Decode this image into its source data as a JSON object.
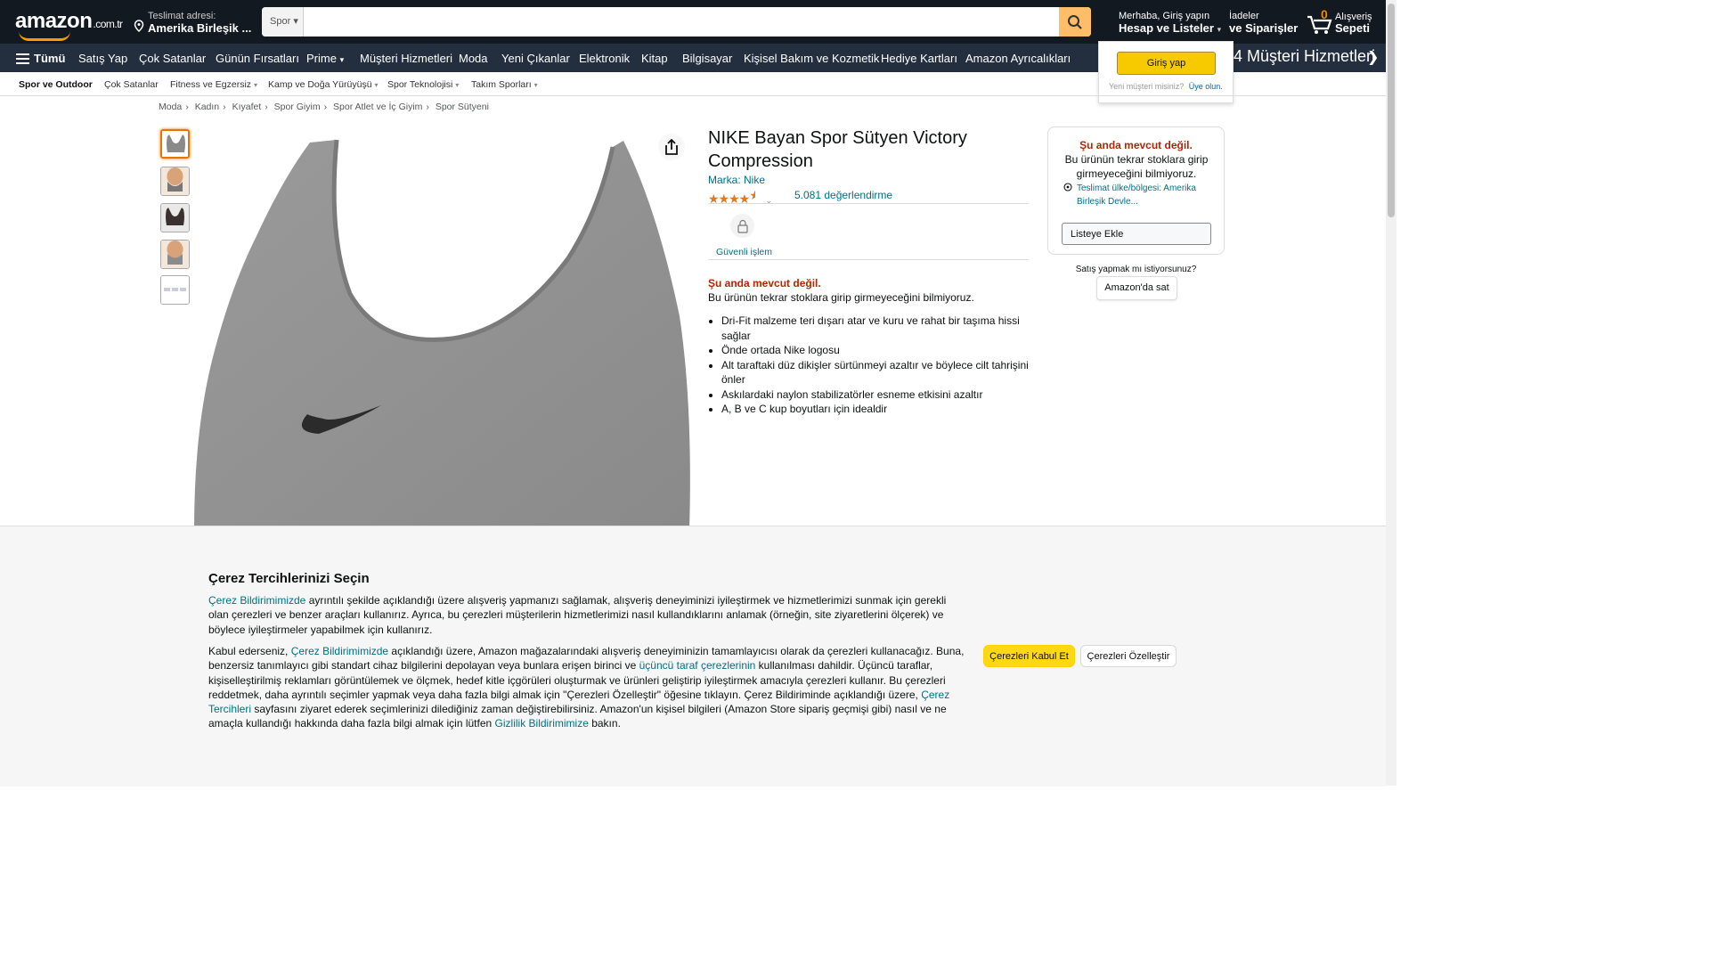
{
  "header": {
    "logo_text": "amazon",
    "logo_tld": ".com.tr",
    "deliver_line1": "Teslimat adresi:",
    "deliver_line2": "Amerika Birleşik ...",
    "search_category": "Spor",
    "search_placeholder": "",
    "account_line1": "Merhaba, Giriş yapın",
    "account_line2": "Hesap ve Listeler",
    "orders_line1": "İadeler",
    "orders_line2": "ve Siparişler",
    "cart_count": "0",
    "cart_line1": "Alışveriş",
    "cart_line2": "Sepeti"
  },
  "nav": {
    "all": "Tümü",
    "items": [
      "Satış Yap",
      "Çok Satanlar",
      "Günün Fırsatları",
      "Prime",
      "Müşteri Hizmetleri",
      "Moda",
      "Yeni Çıkanlar",
      "Elektronik",
      "Kitap",
      "Bilgisayar",
      "Kişisel Bakım ve Kozmetik",
      "Hediye Kartları",
      "Amazon Ayrıcalıkları"
    ],
    "banner": "7/24 Müşteri Hizmetleri"
  },
  "signin_popup": {
    "button": "Giriş yap",
    "new_customer": "Yeni müşteri misiniz?",
    "signup_link": "Üye olun."
  },
  "subnav": {
    "items": [
      "Spor ve Outdoor",
      "Çok Satanlar",
      "Fitness ve Egzersiz",
      "Kamp ve Doğa Yürüyüşü",
      "Spor Teknolojisi",
      "Takım Sporları"
    ]
  },
  "breadcrumb": [
    "Moda",
    "Kadın",
    "Kıyafet",
    "Spor Giyim",
    "Spor Atlet ve İç Giyim",
    "Spor Sütyeni"
  ],
  "product": {
    "title": "NIKE Bayan Spor Sütyen Victory Compression",
    "brand": "Marka: Nike",
    "rating_count": "5.081 değerlendirme",
    "rating": 4.5,
    "secure": "Güvenli işlem",
    "unavailable": "Şu anda mevcut değil.",
    "unavailable_sub": "Bu ürünün tekrar stoklara girip girmeyeceğini bilmiyoruz.",
    "bullets": [
      "Dri-Fit malzeme teri dışarı atar ve kuru ve rahat bir taşıma hissi sağlar",
      "Önde ortada Nike logosu",
      "Alt taraftaki düz dikişler sürtünmeyi azaltır ve böylece cilt tahrişini önler",
      "Askılardaki naylon stabilizatörler esneme etkisini azaltır",
      "A, B ve C kup boyutları için idealdir"
    ]
  },
  "buybox": {
    "unavailable": "Şu anda mevcut değil.",
    "sub": "Bu ürünün tekrar stoklara girip girmeyeceğini bilmiyoruz.",
    "location": "Teslimat ülke/bölgesi: Amerika Birleşik Devle...",
    "add_to_list": "Listeye Ekle",
    "sell_question": "Satış yapmak mı istiyorsunuz?",
    "sell_button": "Amazon'da sat"
  },
  "cookie": {
    "title": "Çerez Tercihlerinizi Seçin",
    "p1_link": "Çerez Bildirimimizde",
    "p1_text": " ayrıntılı şekilde açıklandığı üzere alışveriş yapmanızı sağlamak, alışveriş deneyiminizi iyileştirmek ve hizmetlerimizi sunmak için gerekli olan çerezleri ve benzer araçları kullanırız. Ayrıca, bu çerezleri müşterilerin hizmetlerimizi nasıl kullandıklarını anlamak (örneğin, site ziyaretlerini ölçerek) ve böylece iyileştirmeler yapabilmek için kullanırız.",
    "p2_a": "Kabul ederseniz, ",
    "p2_link1": "Çerez Bildirimimizde",
    "p2_b": " açıklandığı üzere, Amazon mağazalarındaki alışveriş deneyiminizin tamamlayıcısı olarak da çerezleri kullanacağız. Buna, benzersiz tanımlayıcı gibi standart cihaz bilgilerini depolayan veya bunlara erişen birinci ve ",
    "p2_link2": "üçüncü taraf çerezlerinin",
    "p2_c": " kullanılması dahildir. Üçüncü taraflar, kişiselleştirilmiş reklamları görüntülemek ve ölçmek, hedef kitle içgörüleri oluşturmak ve ürünleri geliştirip iyileştirmek amacıyla çerezleri kullanır. Bu çerezleri reddetmek, daha ayrıntılı seçimler yapmak veya daha fazla bilgi almak için \"Çerezleri Özelleştir\" öğesine tıklayın. Çerez Bildiriminde açıklandığı üzere, ",
    "p2_link3": "Çerez Tercihleri",
    "p2_d": " sayfasını ziyaret ederek seçimlerinizi dilediğiniz zaman değiştirebilirsiniz. Amazon'un kişisel bilgileri (Amazon Store sipariş geçmişi gibi) nasıl ve ne amaçla kullandığı hakkında daha fazla bilgi almak için lütfen ",
    "p2_link4": "Gizlilik Bildirimimize",
    "p2_e": " bakın.",
    "accept": "Çerezleri Kabul Et",
    "customize": "Çerezleri Özelleştir"
  }
}
